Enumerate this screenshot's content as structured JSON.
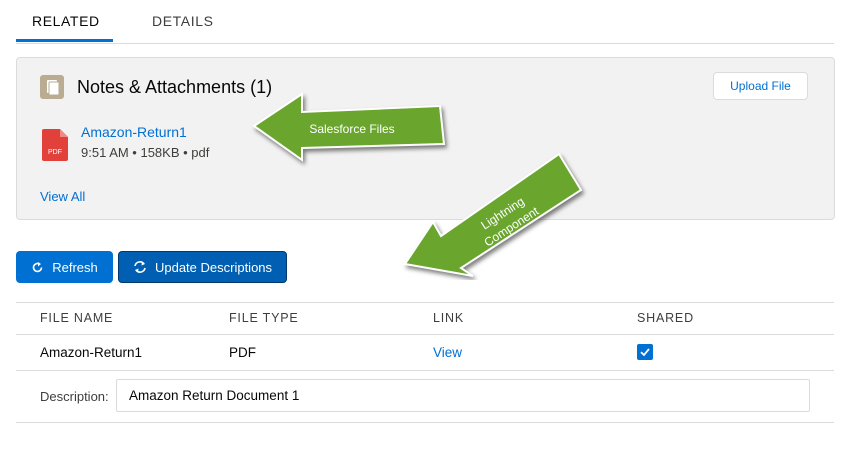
{
  "tabs": [
    {
      "label": "RELATED",
      "active": true
    },
    {
      "label": "DETAILS",
      "active": false
    }
  ],
  "notes_card": {
    "title": "Notes & Attachments (1)",
    "upload_label": "Upload File",
    "file": {
      "name": "Amazon-Return1",
      "meta": "9:51 AM • 158KB • pdf",
      "icon_text": "PDF"
    },
    "view_all": "View All"
  },
  "annotations": {
    "files_arrow": "Salesforce Files",
    "component_arrow_line1": "Lightning",
    "component_arrow_line2": "Component"
  },
  "toolbar": {
    "refresh_label": "Refresh",
    "update_label": "Update Descriptions"
  },
  "table": {
    "headers": [
      "FILE NAME",
      "FILE TYPE",
      "LINK",
      "SHARED"
    ],
    "rows": [
      {
        "file_name": "Amazon-Return1",
        "file_type": "PDF",
        "link": "View",
        "shared": true
      }
    ],
    "description_label": "Description:",
    "description_value": "Amazon Return Document 1"
  },
  "colors": {
    "brand": "#0070d2",
    "arrow_green": "#6aa62e",
    "pdf_red": "#e2413b"
  }
}
